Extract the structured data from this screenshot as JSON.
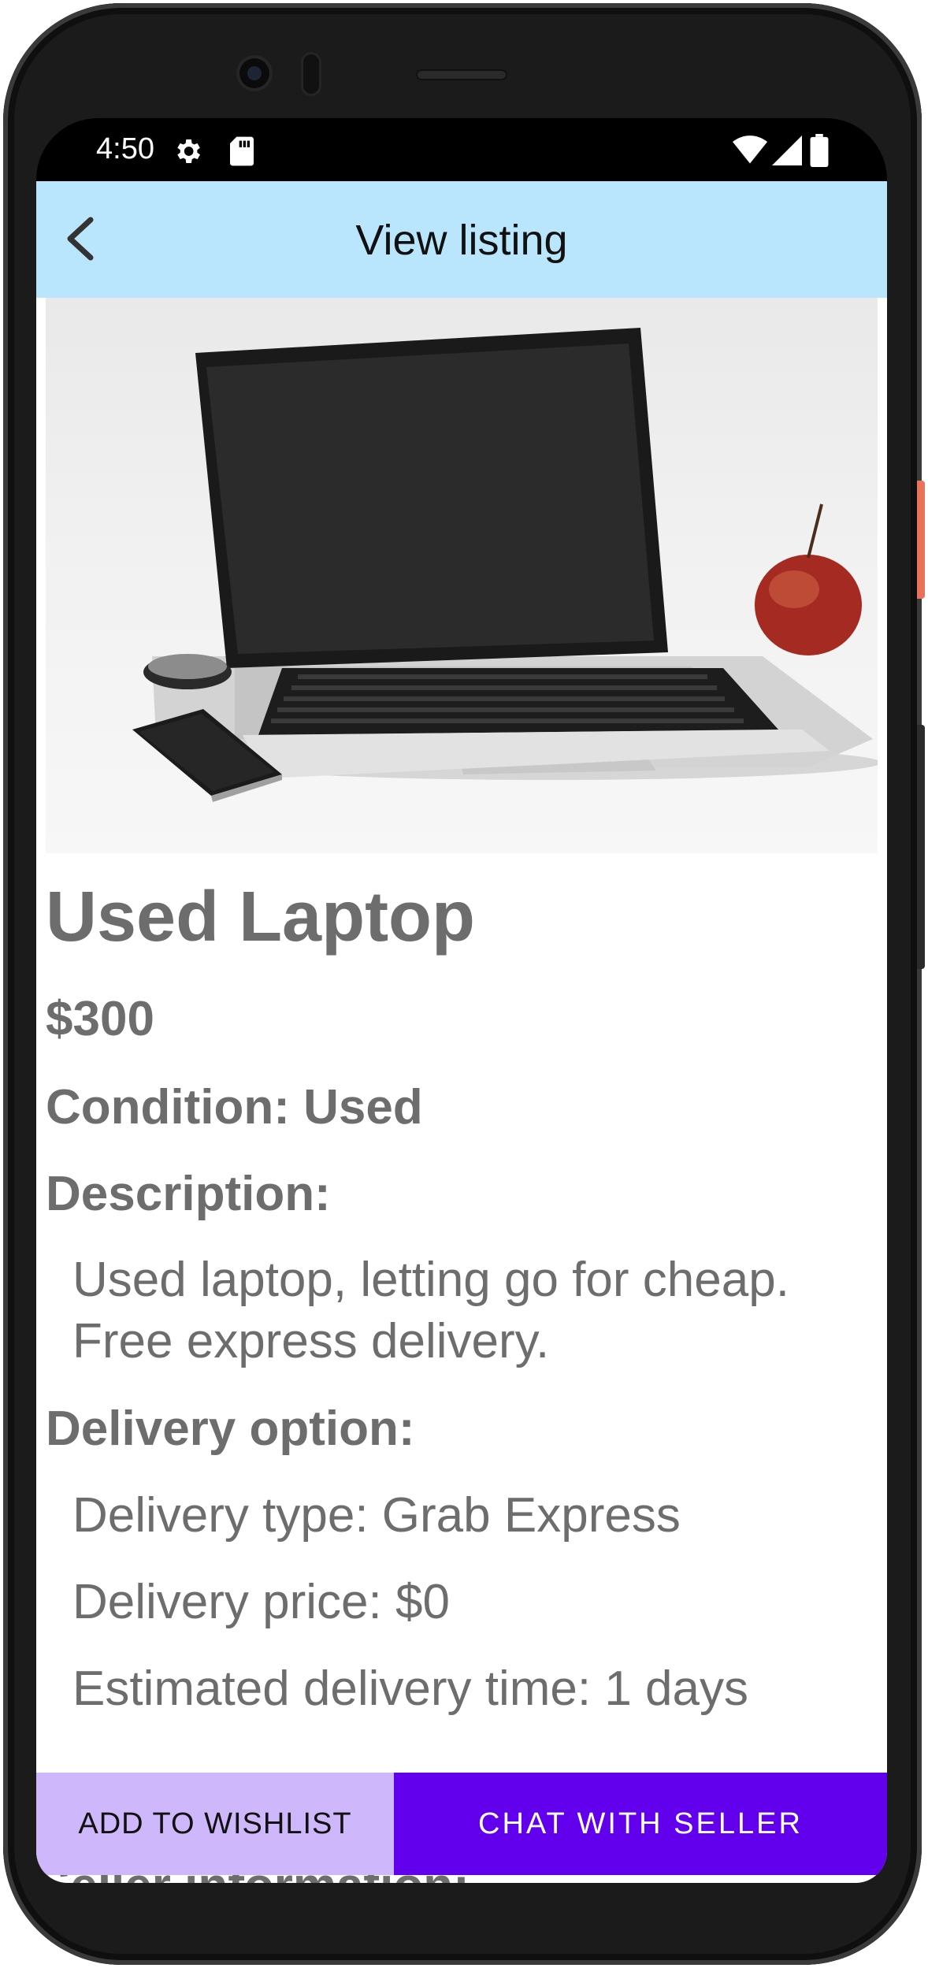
{
  "status_bar": {
    "time": "4:50",
    "icons": [
      "settings-icon",
      "sd-card-icon",
      "wifi-icon",
      "signal-icon",
      "battery-icon"
    ]
  },
  "app_bar": {
    "title": "View listing",
    "back_icon": "chevron-left-icon",
    "background": "#b9e6fc"
  },
  "listing": {
    "image_subject": "laptop-photo",
    "title": "Used Laptop",
    "price": "$300",
    "condition": "Condition: Used",
    "description_label": "Description:",
    "description": "Used laptop, letting go for cheap. Free express delivery.",
    "delivery_label": "Delivery option:",
    "delivery_type": "Delivery type: Grab Express",
    "delivery_price": "Delivery price: $0",
    "delivery_time": "Estimated delivery time: 1 days",
    "seller_label": "Seller information:"
  },
  "actions": {
    "wishlist_label": "ADD TO WISHLIST",
    "chat_label": "CHAT WITH SELLER",
    "wishlist_color": "#cfb7fb",
    "chat_color": "#6200ee"
  }
}
